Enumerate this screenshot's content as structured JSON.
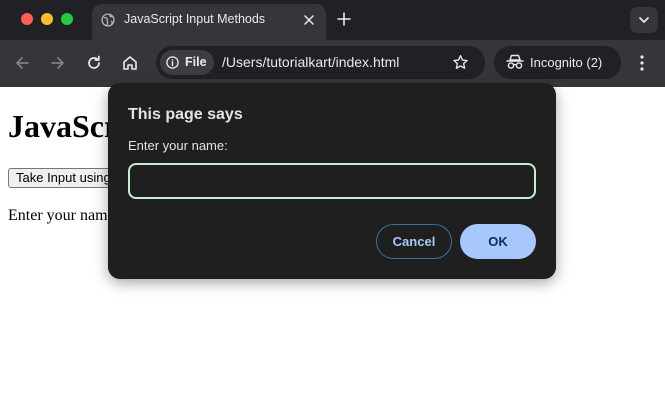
{
  "browser": {
    "tab": {
      "title": "JavaScript Input Methods",
      "favicon": "globe-icon"
    },
    "address_bar": {
      "chip_label": "File",
      "url": "/Users/tutorialkart/index.html"
    },
    "incognito": {
      "label": "Incognito (2)"
    }
  },
  "page": {
    "heading": "JavaScript Input Methods",
    "button_label": "Take Input using Prompt",
    "text": "Enter your name:"
  },
  "dialog": {
    "title": "This page says",
    "message": "Enter your name:",
    "input_value": "",
    "cancel_label": "Cancel",
    "ok_label": "OK"
  },
  "colors": {
    "chrome_dark": "#202124",
    "toolbar": "#35363a",
    "dialog_bg": "#1f1f1f",
    "accent": "#a8c7fa",
    "input_focus": "#c4eed0"
  }
}
